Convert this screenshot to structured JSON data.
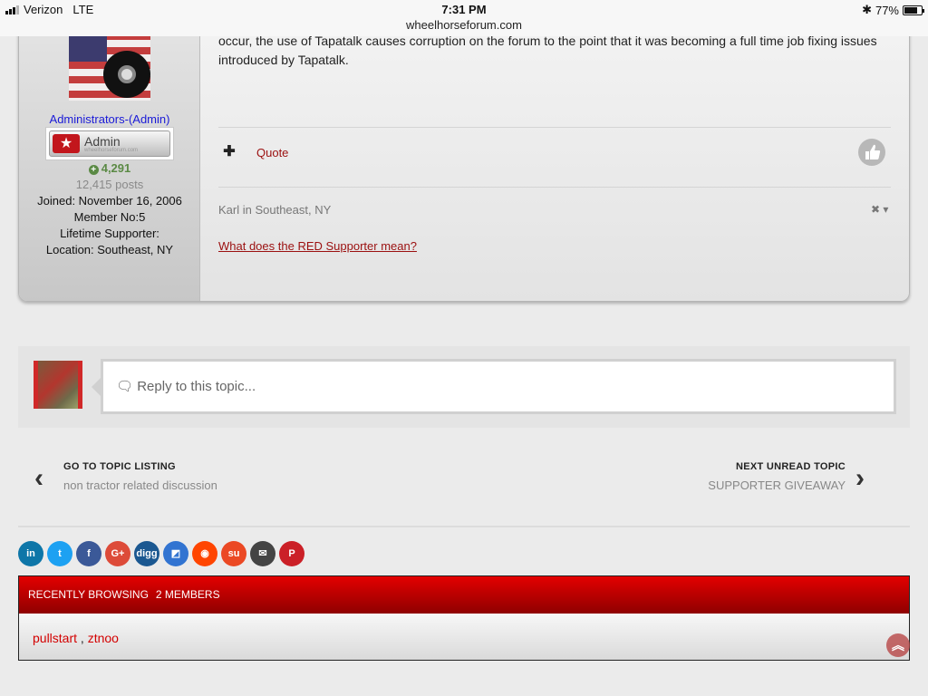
{
  "status_bar": {
    "carrier": "Verizon",
    "network": "LTE",
    "time": "7:31 PM",
    "url": "wheelhorseforum.com",
    "battery": "77%",
    "battery_level": 0.77
  },
  "post": {
    "author": {
      "role": "Administrators-(Admin)",
      "badge": "Admin",
      "badge_sub": "wheelhorseforum.com",
      "reputation": "4,291",
      "posts": "12,415 posts",
      "info": [
        "Joined: November 16, 2006",
        "Member No:5",
        "Lifetime Supporter:",
        "Location: Southeast, NY"
      ]
    },
    "body_lines": [
      "occur, the use of Tapatalk causes corruption on the forum to the point that it was becoming a full time job fixing issues",
      "introduced by Tapatalk."
    ],
    "quote_label": "Quote",
    "signature": "Karl in Southeast, NY",
    "supporter_link": "What does the RED Supporter mean?"
  },
  "reply": {
    "placeholder": "Reply to this topic..."
  },
  "topic_nav": {
    "prev_title": "GO TO TOPIC LISTING",
    "prev_sub": "non tractor related discussion",
    "next_title": "NEXT UNREAD TOPIC",
    "next_sub": "SUPPORTER GIVEAWAY"
  },
  "share": [
    {
      "name": "linkedin-icon",
      "glyph": "in",
      "color": "#0e76a8"
    },
    {
      "name": "twitter-icon",
      "glyph": "t",
      "color": "#1da1f2"
    },
    {
      "name": "facebook-icon",
      "glyph": "f",
      "color": "#3b5998"
    },
    {
      "name": "google-plus-icon",
      "glyph": "G+",
      "color": "#dd4b39"
    },
    {
      "name": "digg-icon",
      "glyph": "digg",
      "color": "#1b5891"
    },
    {
      "name": "delicious-icon",
      "glyph": "◩",
      "color": "#3274d1"
    },
    {
      "name": "reddit-icon",
      "glyph": "◉",
      "color": "#ff4500"
    },
    {
      "name": "stumbleupon-icon",
      "glyph": "su",
      "color": "#eb4924"
    },
    {
      "name": "email-icon",
      "glyph": "✉",
      "color": "#444444"
    },
    {
      "name": "pinterest-icon",
      "glyph": "P",
      "color": "#cb2027"
    }
  ],
  "recently_browsing": {
    "label": "RECENTLY BROWSING",
    "count": "2 MEMBERS",
    "members": [
      "pullstart",
      "ztnoo"
    ]
  }
}
